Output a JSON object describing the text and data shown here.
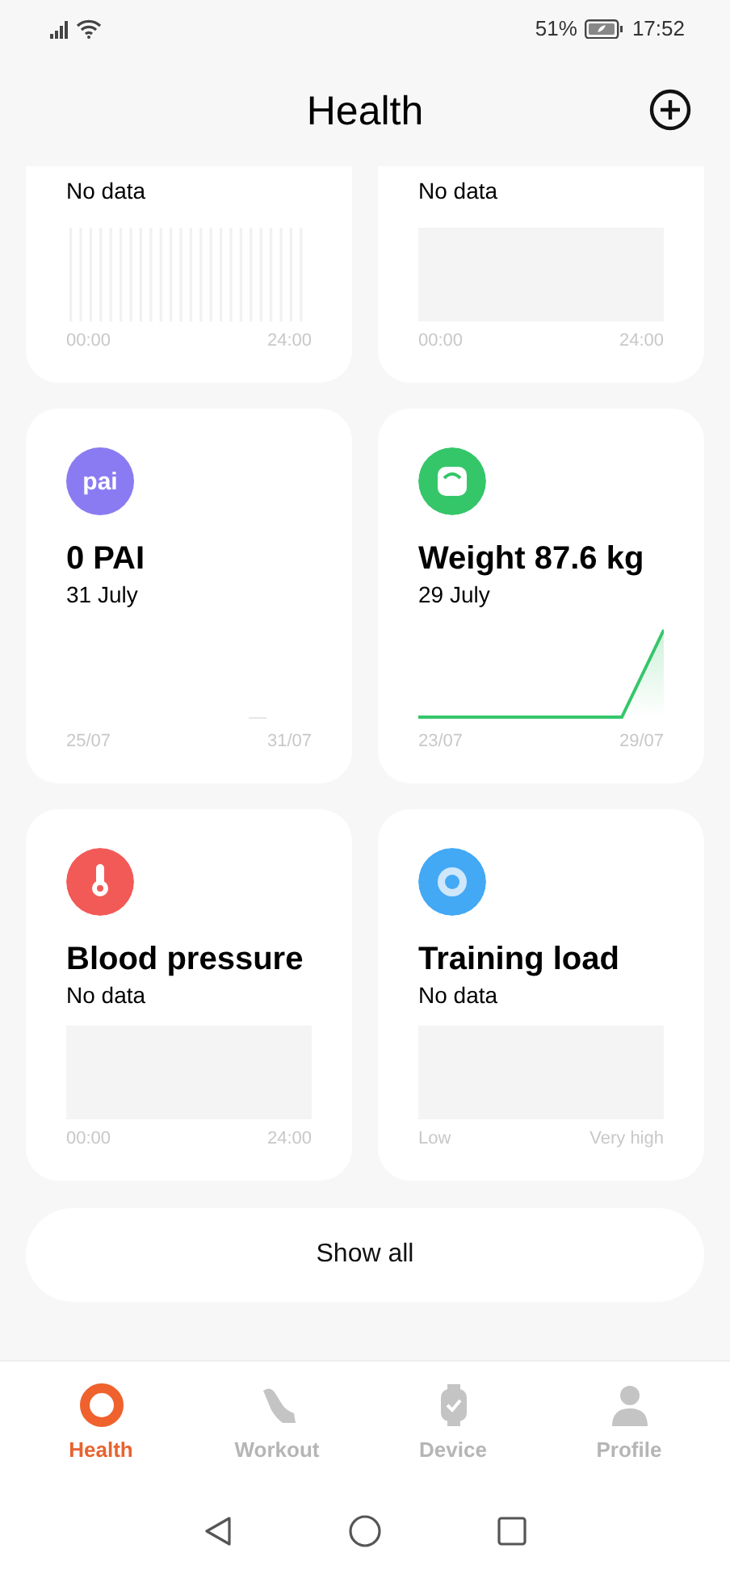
{
  "status_bar": {
    "battery": "51%",
    "time": "17:52"
  },
  "header": {
    "title": "Health"
  },
  "cards": [
    {
      "kind": "bars",
      "subtitle": "No data",
      "axis": [
        "00:00",
        "24:00"
      ]
    },
    {
      "kind": "empty",
      "subtitle": "No data",
      "axis": [
        "00:00",
        "24:00"
      ]
    },
    {
      "kind": "sparse",
      "badge": "pai",
      "title": "0 PAI",
      "subtitle": "31 July",
      "color": "#8b7bf2",
      "axis": [
        "25/07",
        "31/07"
      ]
    },
    {
      "kind": "line",
      "title": "Weight 87.6 kg",
      "subtitle": "29 July",
      "color": "#35c66a",
      "axis": [
        "23/07",
        "29/07"
      ]
    },
    {
      "kind": "empty",
      "title": "Blood pressure",
      "subtitle": "No data",
      "color": "#f25a57",
      "axis": [
        "00:00",
        "24:00"
      ]
    },
    {
      "kind": "empty",
      "title": "Training load",
      "subtitle": "No data",
      "color": "#43a9f5",
      "axis": [
        "Low",
        "Very high"
      ]
    }
  ],
  "show_all": "Show all",
  "tabs": [
    {
      "label": "Health",
      "selected": true
    },
    {
      "label": "Workout",
      "selected": false
    },
    {
      "label": "Device",
      "selected": false
    },
    {
      "label": "Profile",
      "selected": false
    }
  ]
}
